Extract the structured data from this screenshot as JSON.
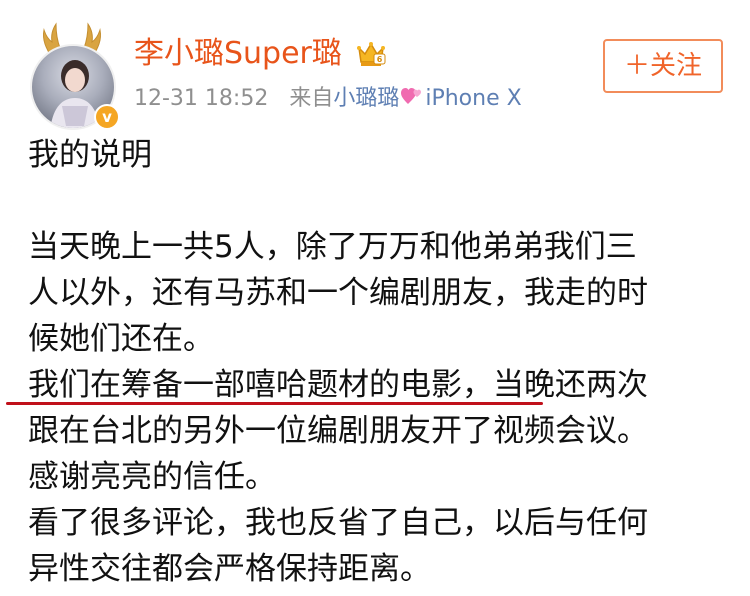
{
  "header": {
    "username": "李小璐Super璐",
    "crown_icon": "vip-crown-icon",
    "verified_icon": "verified-badge-icon",
    "timestamp": "12-31 18:52",
    "source_prefix": "来自",
    "source_name": "小璐璐",
    "heart_icon": "pink-hearts-icon",
    "device": "iPhone X",
    "follow_label": "＋关注"
  },
  "post": {
    "title": "我的说明",
    "lines": [
      "当天晚上一共5人，除了万万和他弟弟我们三",
      "人以外，还有马苏和一个编剧朋友，我走的时",
      "候她们还在。",
      "我们在筹备一部嘻哈题材的电影，当晚还两次",
      "跟在台北的另外一位编剧朋友开了视频会议。",
      "感谢亮亮的信任。",
      "看了很多评论，我也反省了自己，以后与任何",
      "异性交往都会严格保持距离。"
    ]
  },
  "colors": {
    "username": "#e8541a",
    "meta": "#8f8f8f",
    "link": "#5e7fb3",
    "follow_border": "#f28c5a",
    "follow_text": "#f0642a",
    "underline": "#c0101a",
    "verified": "#f5a623"
  }
}
